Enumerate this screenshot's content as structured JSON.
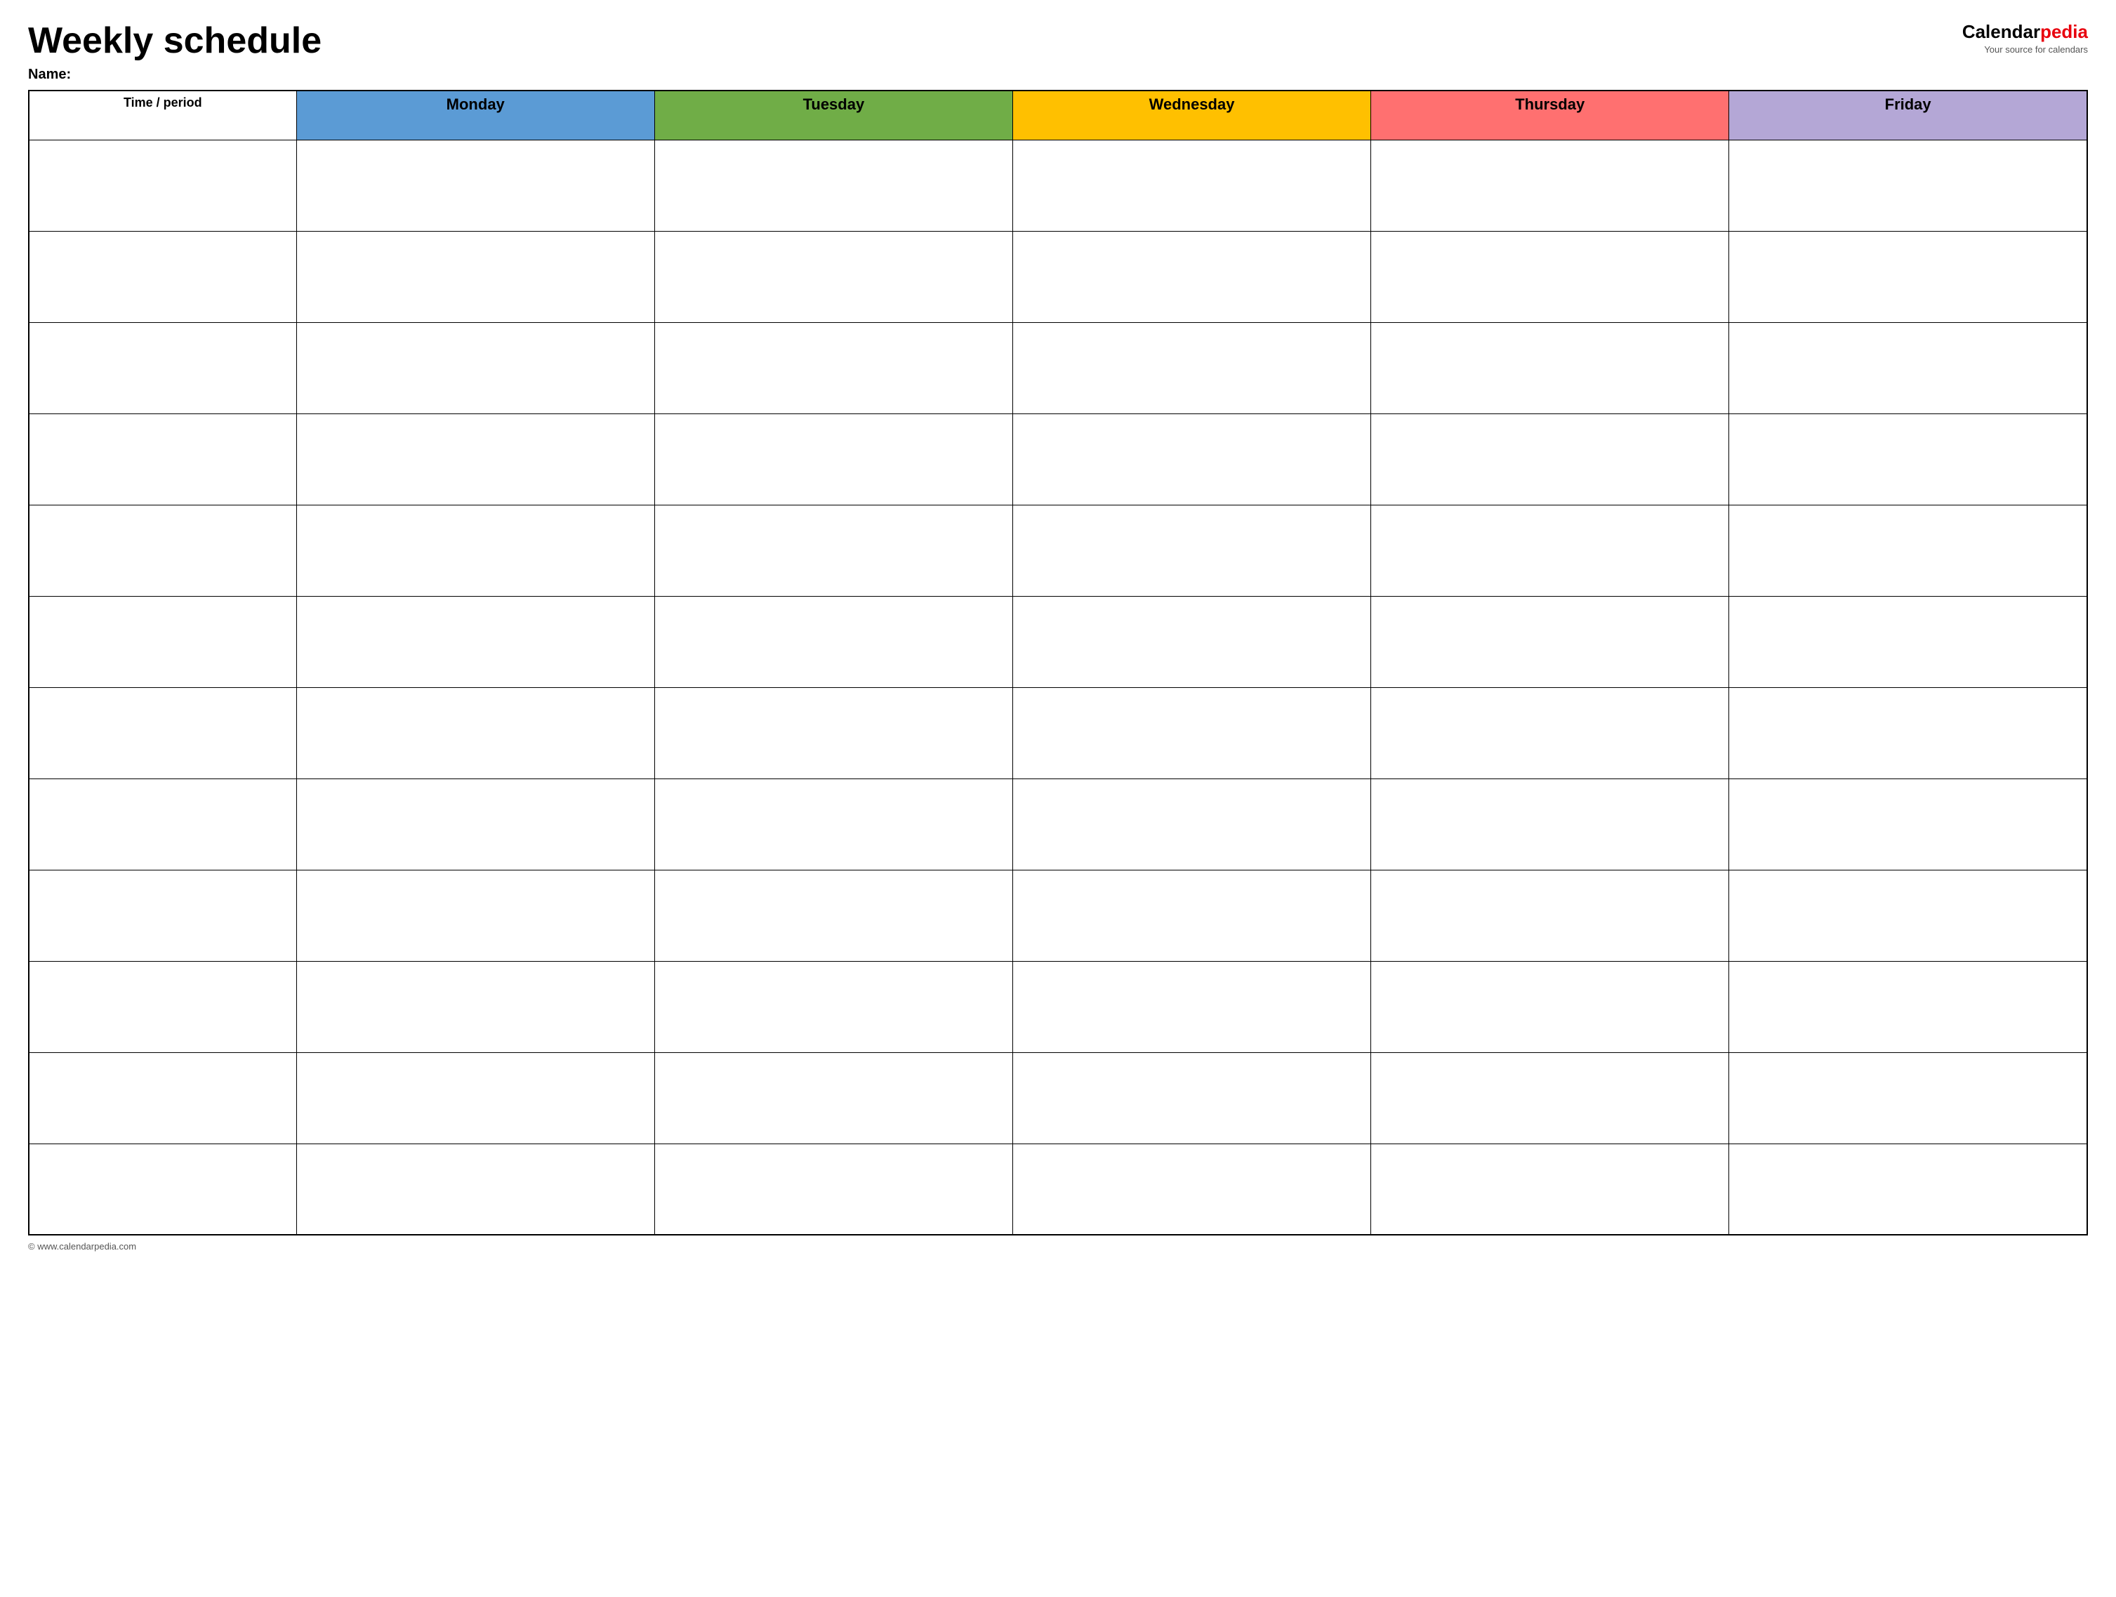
{
  "header": {
    "title": "Weekly schedule",
    "name_label": "Name:",
    "logo": {
      "calendar_text": "Calendar",
      "pedia_text": "pedia",
      "tagline": "Your source for calendars"
    }
  },
  "table": {
    "columns": [
      {
        "id": "time",
        "label": "Time / period",
        "color": "#ffffff"
      },
      {
        "id": "monday",
        "label": "Monday",
        "color": "#5b9bd5"
      },
      {
        "id": "tuesday",
        "label": "Tuesday",
        "color": "#70ad47"
      },
      {
        "id": "wednesday",
        "label": "Wednesday",
        "color": "#ffc000"
      },
      {
        "id": "thursday",
        "label": "Thursday",
        "color": "#ff7070"
      },
      {
        "id": "friday",
        "label": "Friday",
        "color": "#b4a7d6"
      }
    ],
    "row_count": 12
  },
  "footer": {
    "url": "© www.calendarpedia.com"
  }
}
